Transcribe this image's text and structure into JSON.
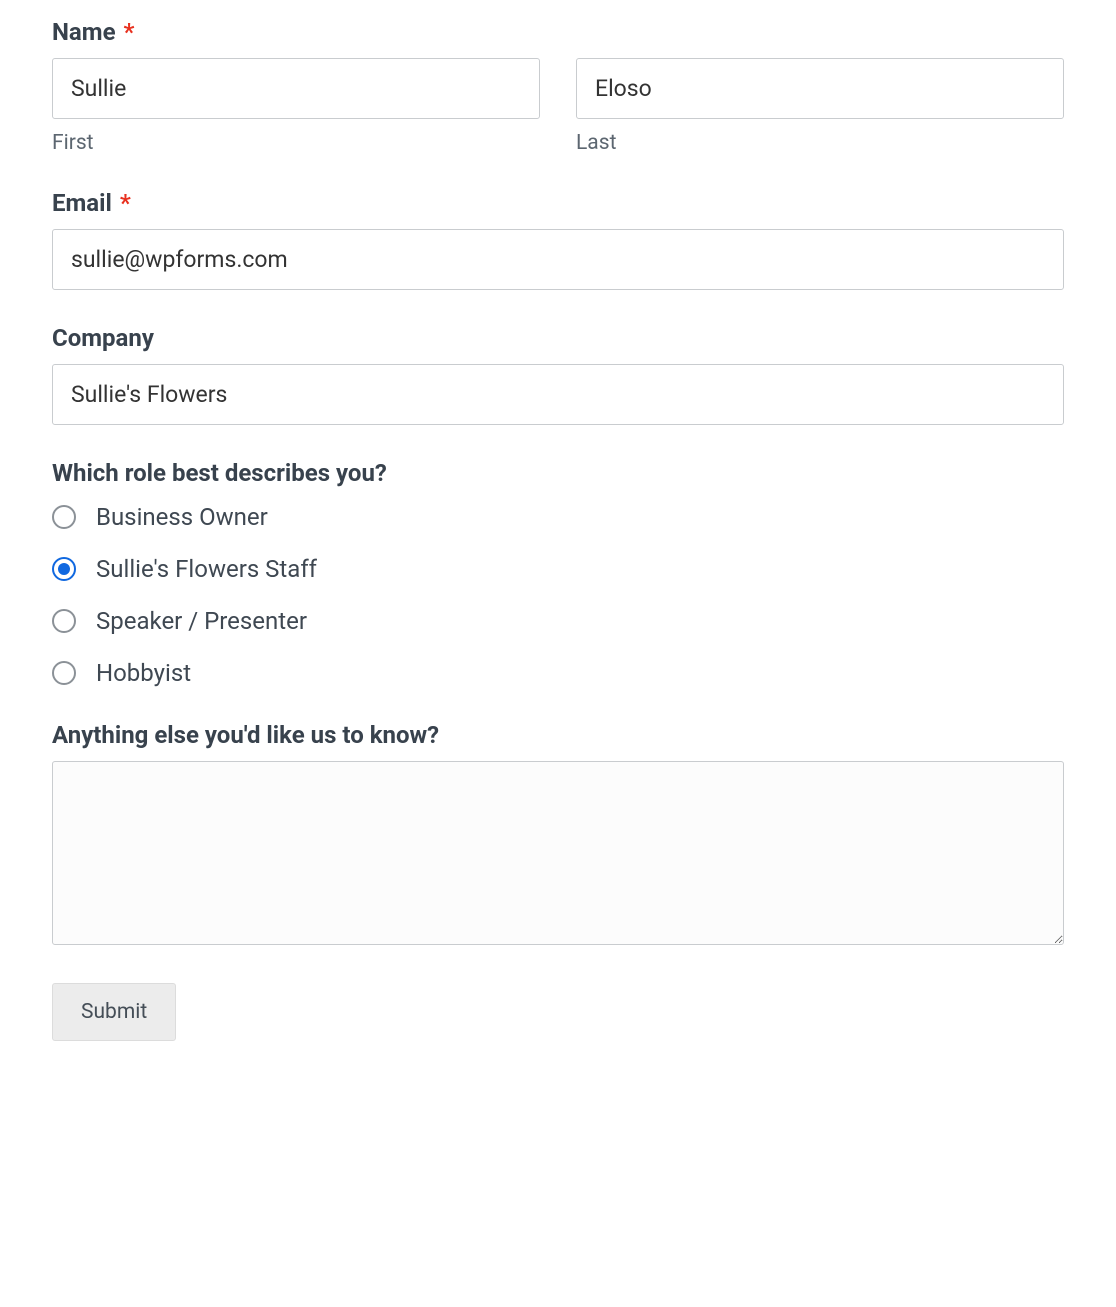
{
  "fields": {
    "name": {
      "label": "Name",
      "required": true,
      "first": {
        "sublabel": "First",
        "value": "Sullie"
      },
      "last": {
        "sublabel": "Last",
        "value": "Eloso"
      }
    },
    "email": {
      "label": "Email",
      "required": true,
      "value": "sullie@wpforms.com"
    },
    "company": {
      "label": "Company",
      "required": false,
      "value": "Sullie's Flowers"
    },
    "role": {
      "label": "Which role best describes you?",
      "options": [
        {
          "label": "Business Owner",
          "checked": false
        },
        {
          "label": "Sullie's Flowers Staff",
          "checked": true
        },
        {
          "label": "Speaker / Presenter",
          "checked": false
        },
        {
          "label": "Hobbyist",
          "checked": false
        }
      ]
    },
    "comments": {
      "label": "Anything else you'd like us to know?",
      "value": ""
    }
  },
  "submit": {
    "label": "Submit"
  },
  "required_marker": "*"
}
